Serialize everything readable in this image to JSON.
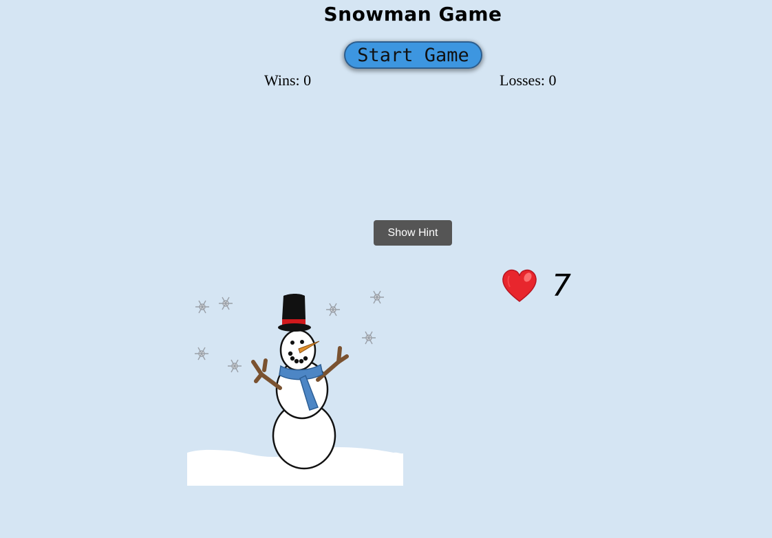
{
  "game": {
    "title": "Snowman Game",
    "start_button": "Start Game",
    "hint_button": "Show Hint"
  },
  "scoreboard": {
    "wins_text": "Wins: 0",
    "losses_text": "Losses: 0"
  },
  "lives": {
    "icon": "heart-icon",
    "count": "7"
  },
  "illustration": {
    "name": "snowman",
    "scarf_color": "#4d86c5",
    "hat_band_color": "#d0191c"
  },
  "colors": {
    "background": "#d5e5f3",
    "start_button": "#3d96e0",
    "hint_button": "#555555",
    "heart": "#e8262d"
  }
}
